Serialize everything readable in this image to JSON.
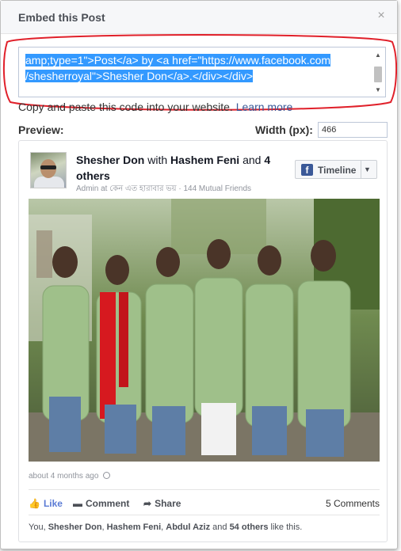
{
  "dialog": {
    "title": "Embed this Post",
    "close": "×"
  },
  "code": {
    "line1": "amp;type=1\">Post</a> by <a href=\"https://www.facebook.com",
    "line2": "/shesherroyal\">Shesher Don</a>.</div></div>"
  },
  "hint": {
    "text": "Copy and paste this code into your website.",
    "learn_more": "Learn more"
  },
  "preview": {
    "label": "Preview:",
    "width_label": "Width (px):",
    "width_value": "466"
  },
  "post": {
    "author": "Shesher Don",
    "with_word": "with",
    "tagged": "Hashem Feni",
    "and_word": "and",
    "others": "4 others",
    "meta": "Admin at কেন এত হারাবার ভয় · 144 Mutual Friends",
    "timeline_button": "Timeline",
    "time": "about 4 months ago",
    "actions": {
      "like": "Like",
      "comment": "Comment",
      "share": "Share",
      "comments_count": "5 Comments"
    },
    "likes_line": {
      "prefix": "You, ",
      "names": [
        "Shesher Don",
        "Hashem Feni",
        "Abdul Aziz"
      ],
      "and_word": "and",
      "count": "54 others",
      "suffix": "like this."
    }
  },
  "colors": {
    "link": "#3b5998",
    "selection": "#3399ff",
    "annotation": "#e0202a"
  }
}
